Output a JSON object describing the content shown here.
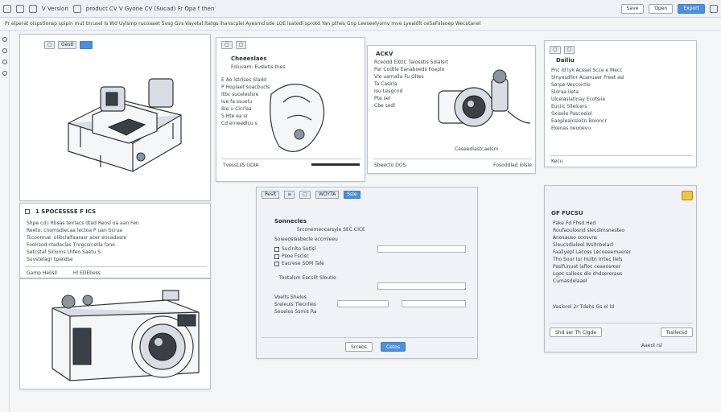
{
  "toolbar": {
    "doc_label": "V Version",
    "title": "product CV V  Gyone CV (Sucad) Fr Opa f then",
    "btn_1": "Save",
    "btn_2": "Open",
    "btn_primary": "Export"
  },
  "menubar": {
    "text": "Pr elperat  olspstionsp spipin mut tnrusel Is  Wd Uylsmp  rucoaaet Svsg  Gvs  Vayetal ltatgs  ihanscplei Ayesmd  sde LOE  lsatedl  sprotd  Yan  pthes  Gnp Leeseelyomv mve  Lyealdlt ceSaFalaoep  Wecotanel"
  },
  "panel_tl": {
    "tab": "Gestl"
  },
  "panel_form": {
    "title": "1 SPOCESSSE F ICS",
    "rows": [
      "Shpe cd l Rbsas teirlacs dtad  Reosl oa aan  Fen",
      "Reeto: cnomsdiecaa lectoa  P uan ticrua",
      "Tccoomue:  olibclalfaarasr  acer eocadasre",
      "Foolrsod ctadaclas  Tnrgcsrcetla fane",
      "Setcstaf  Sirloms Lhfeo   Saetu  S",
      "Suvstelagr  tpieidse"
    ],
    "footer_left": "Gamp Helisll",
    "footer_right": "Hl EDEbess"
  },
  "panel_c": {
    "title": "Cheeeslaes",
    "head": "Foluvam: Eusletis tnes",
    "rows": [
      "E  Ao lstclses Sladd",
      "P  Hoplaet soacbucls",
      "Itbc  suceleslsre",
      "Iue  fa ssuelu",
      "Bie  u  Cicrlaa",
      "S  Hte ea sr",
      "Cd  erneedlcu  s"
    ],
    "footer": "TvessLsS  GDIA"
  },
  "panel_d": {
    "title": "ACKV",
    "rows": [
      "Rceodd  EXOC  Taiosstis  Solalsrt",
      "Par Codtle  Eanaboeds  Foeplo",
      "Vle uamalla  Fu  Gltes",
      "Ta  Casirla",
      "Isu  Lesgcnd",
      "Pte  sel",
      "Cbe  sedl"
    ],
    "caption": "Ceseedlastcaelsm",
    "footer_left": "Sbeecto DOS",
    "footer_right": "Fosoddlad lolsle"
  },
  "panel_e": {
    "title": "Dailiu",
    "rows": [
      "Pnc  Id  lyk Acssel  Scce e Mecc",
      "Slnyesdllor  Acanuaer  Freet  asl",
      "Sorpe  Veccoirtlo",
      "Sloraa      ileta",
      "Ulcelaslatinay  Ecotsiie",
      "Euciic  Sllelcers",
      "Sxisele  Pascoelol",
      "Eaoplealcslosn  Boioncr",
      "Ekeoas oeuoevu"
    ],
    "footer": "Kecu"
  },
  "panel_dialog": {
    "tab_left": "Peslt",
    "tab_mid": "WOYTA",
    "tab_right": "Ssle",
    "title": "Sonnecles",
    "subtitle": "Srconemeocarsyle  SEC CICE",
    "group": "Soieeoslasbecle  eccmleeu",
    "fields": [
      "Suclnlto  Sotlsl",
      "Psoe  Fsclsc",
      "Eacrese  SOM  Tale"
    ],
    "note": "Tootalsm  Eecsllt   Sloutie",
    "list": [
      "Voelts  Sheles",
      "Sreieuls  Tlecnlies",
      "Seuelos  Ssmis  Ra"
    ],
    "btn_ok": "Srceos",
    "btn_cancel": "Cetos"
  },
  "panel_fr": {
    "title": "OF FUCSU",
    "rows": [
      "Pake  Fd  Fhsd Hed",
      "Roufaoulosnd  slecdimsnesteo",
      "Anosauso coosvns",
      "Sleucsdlaleel  Wsltcbelacl",
      "Faallyepl Lacoss  Lecoeeemaerer",
      "Tho Sour Iur Hultn  Irrtec  Ilels",
      "Paslfunuat  lafloc  ceaeosrcer",
      "Lgec  sallees  dle  chdsereraus",
      "Cumasdelaael"
    ],
    "stats": "Vaslorel  2r  Tdehs  Gs  el ld",
    "btn_left": "Shd ser Th Clgde",
    "btn_right": "Tssllecsd",
    "badge": "Aaeol  rsl"
  },
  "colors": {
    "accent": "#4a90e2",
    "panel_border": "#b9c0cb",
    "background": "#f4f5f7"
  }
}
